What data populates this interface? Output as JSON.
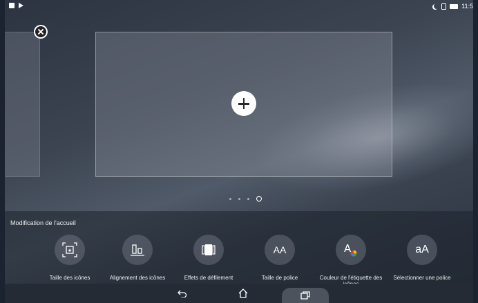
{
  "status_bar": {
    "time": "11:5"
  },
  "pages": {
    "add_page_label": "+",
    "indicator_count": 4,
    "active_index": 3
  },
  "edit_panel": {
    "title": "Modification de l'accueil",
    "options": [
      {
        "label": "Taille des icônes",
        "icon": "icon-size-icon"
      },
      {
        "label": "Alignement des icônes",
        "icon": "icon-alignment-icon"
      },
      {
        "label": "Effets de défilement",
        "icon": "scroll-effects-icon"
      },
      {
        "label": "Taille de police",
        "icon": "font-size-icon",
        "glyph": "AA"
      },
      {
        "label": "Couleur de l'étiquette des icônes",
        "icon": "label-color-icon",
        "glyph": "A"
      },
      {
        "label": "Sélectionner une police",
        "icon": "select-font-icon",
        "glyph": "aA"
      }
    ]
  },
  "navigation": {
    "back": "back-icon",
    "home": "home-icon",
    "recents": "recents-icon"
  }
}
